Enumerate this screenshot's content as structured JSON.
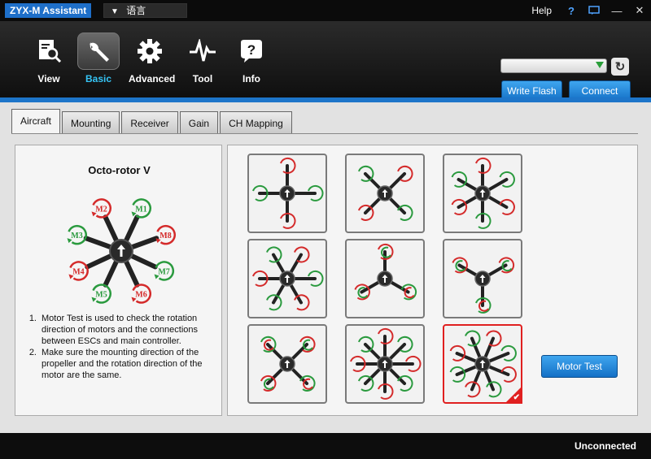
{
  "window": {
    "title": "ZYX-M Assistant",
    "language_label": "语言",
    "help_label": "Help"
  },
  "toolbar": {
    "tools": [
      {
        "label": "View",
        "icon": "view-icon"
      },
      {
        "label": "Basic",
        "icon": "wrench-icon",
        "active": true
      },
      {
        "label": "Advanced",
        "icon": "gear-icon"
      },
      {
        "label": "Tool",
        "icon": "pulse-icon"
      },
      {
        "label": "Info",
        "icon": "info-icon"
      }
    ],
    "port_value": "",
    "write_flash_label": "Write Flash",
    "connect_label": "Connect"
  },
  "tabs": [
    {
      "label": "Aircraft",
      "active": true
    },
    {
      "label": "Mounting"
    },
    {
      "label": "Receiver"
    },
    {
      "label": "Gain"
    },
    {
      "label": "CH Mapping"
    }
  ],
  "aircraft": {
    "title": "Octo-rotor V",
    "motors": [
      "M1",
      "M2",
      "M3",
      "M4",
      "M5",
      "M6",
      "M7",
      "M8"
    ],
    "notes": [
      {
        "num": "1.",
        "text": "Motor Test is used to check the rotation direction of motors and the connections between ESCs and main controller."
      },
      {
        "num": "2.",
        "text": "Make sure the mounting direction of the propeller and the rotation direction of the motor are the same."
      }
    ],
    "motor_test_label": "Motor Test",
    "selected_frame_index": 8
  },
  "status": {
    "connection": "Unconnected"
  },
  "colors": {
    "accent_blue": "#1d75c9",
    "active_tab_text": "#35c4f5",
    "motor_cw_red": "#d42a2a",
    "motor_ccw_green": "#2a9a3e",
    "selected_frame": "#e02020"
  }
}
